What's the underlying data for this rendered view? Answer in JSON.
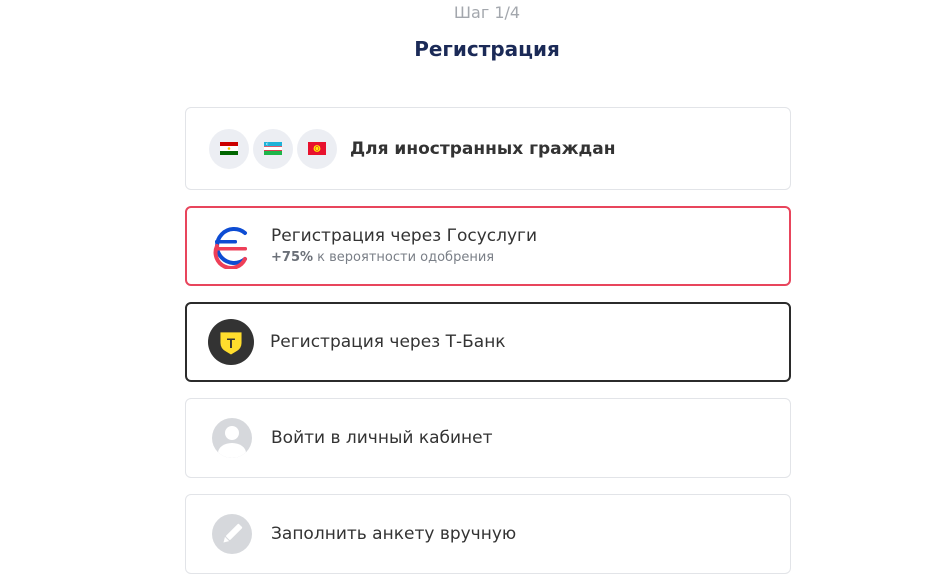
{
  "header": {
    "step": "Шаг 1/4",
    "title": "Регистрация"
  },
  "options": {
    "foreign": {
      "label": "Для иностранных граждан",
      "flags": [
        "tajikistan-flag-icon",
        "uzbekistan-flag-icon",
        "kyrgyzstan-flag-icon"
      ]
    },
    "gosuslugi": {
      "label": "Регистрация через Госуслуги",
      "bonus": "+75%",
      "sub": "к вероятности одобрения",
      "accent": "#e8455c"
    },
    "tbank": {
      "label": "Регистрация через Т-Банк",
      "logo_letter": "Т",
      "accent": "#2b2b2b"
    },
    "login": {
      "label": "Войти в личный кабинет",
      "icon": "user-icon"
    },
    "manual": {
      "label": "Заполнить анкету вручную",
      "icon": "pencil-icon"
    }
  }
}
